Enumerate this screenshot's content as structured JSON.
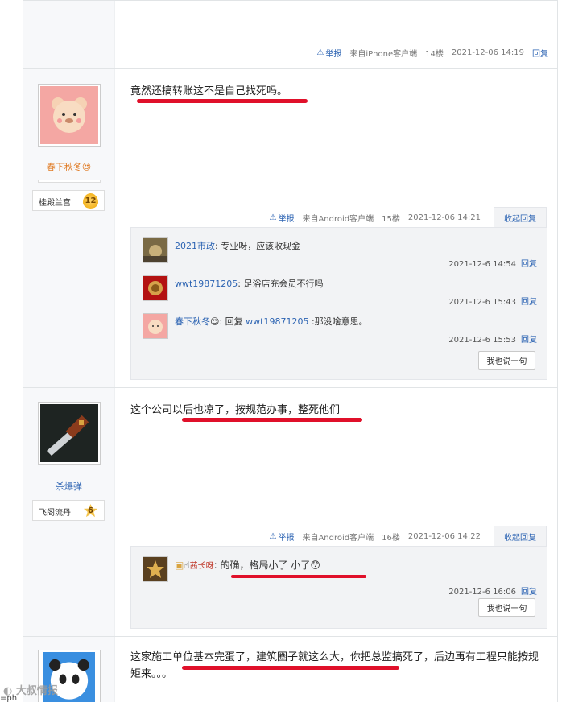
{
  "post14": {
    "report": "举报",
    "from": "来自iPhone客户端",
    "floor": "14楼",
    "time": "2021-12-06 14:19",
    "reply": "回复"
  },
  "post15": {
    "user": "春下秋冬",
    "badge_name": "桂殿兰宫",
    "badge_level": "12",
    "text": "竟然还搞转账这不是自己找死吗。",
    "report": "举报",
    "from": "来自Android客户端",
    "floor": "15楼",
    "time": "2021-12-06 14:21",
    "collapse": "收起回复",
    "replies": [
      {
        "user": "2021市政",
        "text": ": 专业呀，应该收现金",
        "time": "2021-12-6 14:54",
        "reply": "回复"
      },
      {
        "user": "wwt19871205",
        "text": ": 足浴店充会员不行吗",
        "time": "2021-12-6 15:43",
        "reply": "回复"
      },
      {
        "user": "春下秋冬",
        "reply_word": ": 回复 ",
        "target": "wwt19871205",
        "text": " :那没啥意思。",
        "time": "2021-12-6 15:53",
        "reply": "回复"
      }
    ],
    "say": "我也说一句"
  },
  "post16": {
    "user": "杀爆弹",
    "badge_name": "飞阁流丹",
    "badge_level": "6",
    "text": "这个公司以后也凉了，按规范办事，整死他们",
    "report": "举报",
    "from": "来自Android客户端",
    "floor": "16楼",
    "time": "2021-12-06 14:22",
    "collapse": "收起回复",
    "replies": [
      {
        "user": "茜长呀",
        "text": ": 的确，格局小了 小了",
        "time": "2021-12-6 16:06",
        "reply": "回复"
      }
    ],
    "say": "我也说一句"
  },
  "post17": {
    "text": "这家施工单位基本完蛋了，建筑圈子就这么大，你把总监搞死了，后边再有工程只能按规矩来。。。"
  },
  "watermark": "大叔情报",
  "corner": "=ph"
}
